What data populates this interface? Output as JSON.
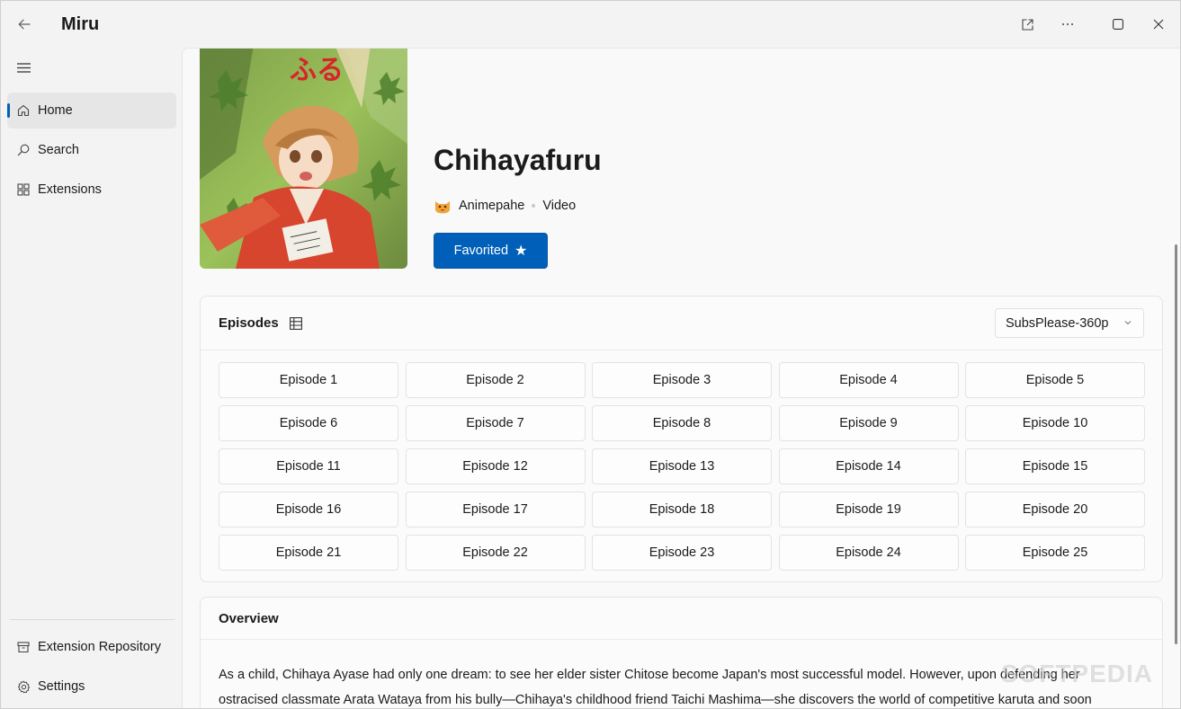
{
  "app": {
    "title": "Miru"
  },
  "titlebar_icons": [
    "back-arrow-icon",
    "open-external-icon",
    "more-icon",
    "maximize-icon",
    "close-icon"
  ],
  "sidebar": {
    "items": [
      {
        "label": "Home",
        "icon": "home-icon",
        "active": true
      },
      {
        "label": "Search",
        "icon": "search-icon",
        "active": false
      },
      {
        "label": "Extensions",
        "icon": "extensions-icon",
        "active": false
      }
    ],
    "footer_items": [
      {
        "label": "Extension Repository",
        "icon": "repository-icon"
      },
      {
        "label": "Settings",
        "icon": "gear-icon"
      }
    ]
  },
  "detail": {
    "title": "Chihayafuru",
    "source": "Animepahe",
    "type": "Video",
    "favorite_label": "Favorited",
    "poster_kanji": "ふる"
  },
  "episodes": {
    "title": "Episodes",
    "source_selected": "SubsPlease-360p",
    "list": [
      "Episode 1",
      "Episode 2",
      "Episode 3",
      "Episode 4",
      "Episode 5",
      "Episode 6",
      "Episode 7",
      "Episode 8",
      "Episode 9",
      "Episode 10",
      "Episode 11",
      "Episode 12",
      "Episode 13",
      "Episode 14",
      "Episode 15",
      "Episode 16",
      "Episode 17",
      "Episode 18",
      "Episode 19",
      "Episode 20",
      "Episode 21",
      "Episode 22",
      "Episode 23",
      "Episode 24",
      "Episode 25"
    ]
  },
  "overview": {
    "title": "Overview",
    "line1": "As a child, Chihaya Ayase had only one dream: to see her elder sister Chitose become Japan's most successful model. However, upon defending her",
    "line2": "ostracised classmate Arata Wataya from his bully—Chihaya's childhood friend Taichi Mashima—she discovers the world of competitive karuta and soon"
  },
  "watermark": "SOFTPEDIA",
  "colors": {
    "accent": "#005fb8",
    "background": "#f3f3f3",
    "panel": "#f9f9f9"
  }
}
